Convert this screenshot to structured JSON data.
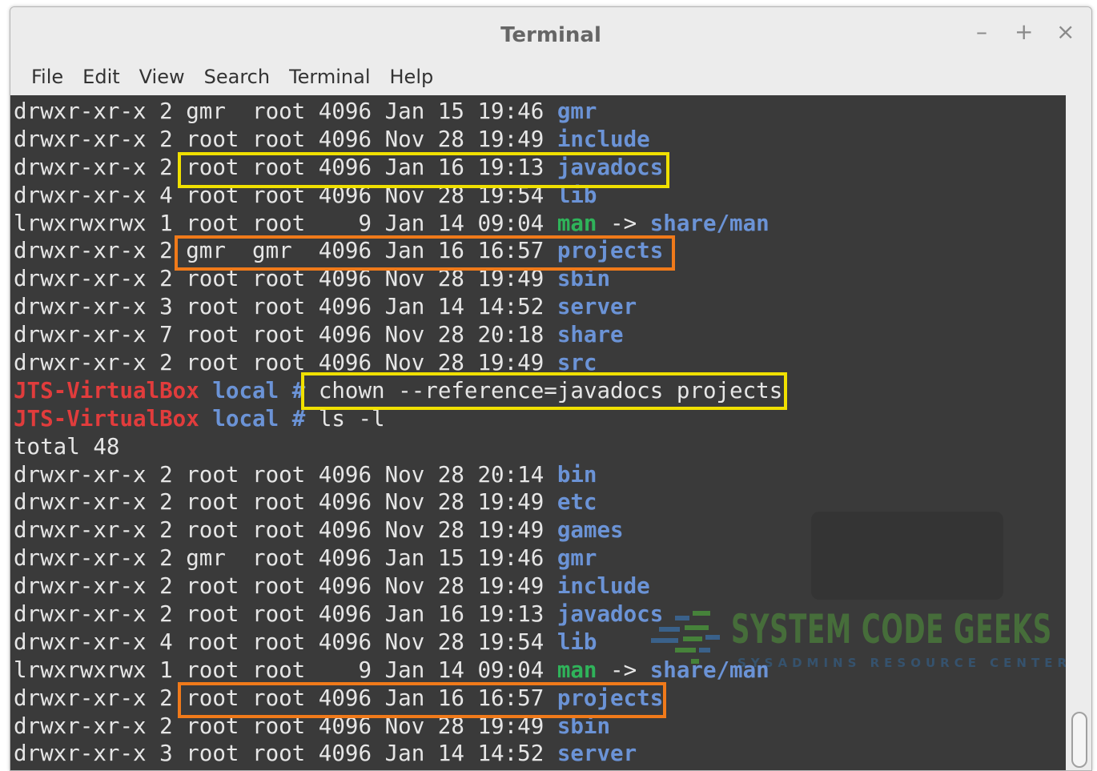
{
  "window": {
    "title": "Terminal"
  },
  "window_buttons": {
    "minimize": "–",
    "maximize": "+",
    "close": "×"
  },
  "menu": [
    "File",
    "Edit",
    "View",
    "Search",
    "Terminal",
    "Help"
  ],
  "watermark": {
    "brand": "SYSTEM CODE GEEKS",
    "tagline": "SYSADMINS RESOURCE CENTER"
  },
  "terminal": {
    "lines": [
      {
        "type": "entry",
        "prefix": "drwxr-xr-x 2 gmr  root 4096 Jan 15 19:46 ",
        "name": "gmr",
        "kind": "dir"
      },
      {
        "type": "entry",
        "prefix": "drwxr-xr-x 2 root root 4096 Nov 28 19:49 ",
        "name": "include",
        "kind": "dir"
      },
      {
        "type": "entry",
        "prefix": "drwxr-xr-x 2 root root 4096 Jan 16 19:13 ",
        "name": "javadocs",
        "kind": "dir"
      },
      {
        "type": "entry",
        "prefix": "drwxr-xr-x 4 root root 4096 Nov 28 19:54 ",
        "name": "lib",
        "kind": "dir"
      },
      {
        "type": "entry",
        "prefix": "lrwxrwxrwx 1 root root    9 Jan 14 09:04 ",
        "name": "man",
        "kind": "link",
        "arrow": " -> ",
        "target": "share/man"
      },
      {
        "type": "entry",
        "prefix": "drwxr-xr-x 2 gmr  gmr  4096 Jan 16 16:57 ",
        "name": "projects",
        "kind": "dir"
      },
      {
        "type": "entry",
        "prefix": "drwxr-xr-x 2 root root 4096 Nov 28 19:49 ",
        "name": "sbin",
        "kind": "dir"
      },
      {
        "type": "entry",
        "prefix": "drwxr-xr-x 3 root root 4096 Jan 14 14:52 ",
        "name": "server",
        "kind": "dir"
      },
      {
        "type": "entry",
        "prefix": "drwxr-xr-x 7 root root 4096 Nov 28 20:18 ",
        "name": "share",
        "kind": "dir"
      },
      {
        "type": "entry",
        "prefix": "drwxr-xr-x 2 root root 4096 Nov 28 19:49 ",
        "name": "src",
        "kind": "dir"
      },
      {
        "type": "prompt",
        "host": "JTS-VirtualBox",
        "cwd": " local # ",
        "command": "chown --reference=javadocs projects"
      },
      {
        "type": "prompt",
        "host": "JTS-VirtualBox",
        "cwd": " local # ",
        "command": "ls -l"
      },
      {
        "type": "text",
        "text": "total 48"
      },
      {
        "type": "entry",
        "prefix": "drwxr-xr-x 2 root root 4096 Nov 28 20:14 ",
        "name": "bin",
        "kind": "dir"
      },
      {
        "type": "entry",
        "prefix": "drwxr-xr-x 2 root root 4096 Nov 28 19:49 ",
        "name": "etc",
        "kind": "dir"
      },
      {
        "type": "entry",
        "prefix": "drwxr-xr-x 2 root root 4096 Nov 28 19:49 ",
        "name": "games",
        "kind": "dir"
      },
      {
        "type": "entry",
        "prefix": "drwxr-xr-x 2 gmr  root 4096 Jan 15 19:46 ",
        "name": "gmr",
        "kind": "dir"
      },
      {
        "type": "entry",
        "prefix": "drwxr-xr-x 2 root root 4096 Nov 28 19:49 ",
        "name": "include",
        "kind": "dir"
      },
      {
        "type": "entry",
        "prefix": "drwxr-xr-x 2 root root 4096 Jan 16 19:13 ",
        "name": "javadocs",
        "kind": "dir"
      },
      {
        "type": "entry",
        "prefix": "drwxr-xr-x 4 root root 4096 Nov 28 19:54 ",
        "name": "lib",
        "kind": "dir"
      },
      {
        "type": "entry",
        "prefix": "lrwxrwxrwx 1 root root    9 Jan 14 09:04 ",
        "name": "man",
        "kind": "link",
        "arrow": " -> ",
        "target": "share/man"
      },
      {
        "type": "entry",
        "prefix": "drwxr-xr-x 2 root root 4096 Jan 16 16:57 ",
        "name": "projects",
        "kind": "dir"
      },
      {
        "type": "entry",
        "prefix": "drwxr-xr-x 2 root root 4096 Nov 28 19:49 ",
        "name": "sbin",
        "kind": "dir"
      },
      {
        "type": "entry",
        "prefix": "drwxr-xr-x 3 root root 4096 Jan 14 14:52 ",
        "name": "server",
        "kind": "dir"
      }
    ]
  },
  "colors": {
    "terminal_bg": "#3a3a3a",
    "directory": "#6b93d6",
    "symlink": "#2fb35a",
    "prompt_host": "#e13c3c",
    "highlight_yellow": "#f0e000",
    "highlight_orange": "#f07a1a"
  }
}
